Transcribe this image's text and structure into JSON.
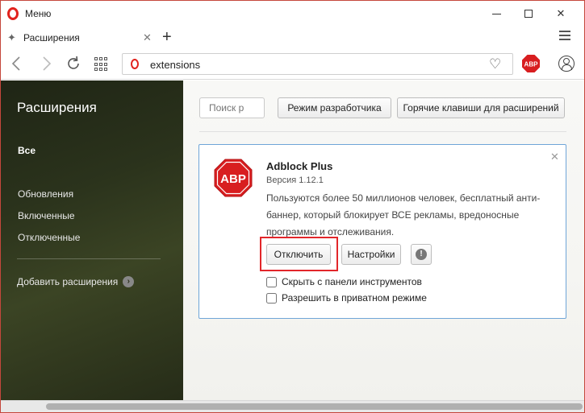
{
  "window": {
    "title": "Меню"
  },
  "tab": {
    "title": "Расширения",
    "close": "✕",
    "new_tab": "+"
  },
  "toolbar": {
    "url": "extensions"
  },
  "sidebar": {
    "title": "Расширения",
    "items": [
      {
        "label": "Все"
      },
      {
        "label": "Обновления"
      },
      {
        "label": "Включенные"
      },
      {
        "label": "Отключенные"
      }
    ],
    "add_label": "Добавить расширения"
  },
  "main": {
    "search_placeholder": "Поиск р",
    "dev_mode_label": "Режим разработчика",
    "hotkeys_label": "Горячие клавиши для расширений"
  },
  "extension": {
    "name": "Adblock Plus",
    "version": "Версия 1.12.1",
    "description": "Пользуются более 50 миллионов человек, бесплатный анти-баннер, который блокирует ВСЕ рекламы, вредоносные программы и отслеживания.",
    "logo_text": "ABP",
    "disable_label": "Отключить",
    "settings_label": "Настройки",
    "info_label": "!",
    "hide_toolbar_label": "Скрыть с панели инструментов",
    "private_mode_label": "Разрешить в приватном режиме",
    "hide_toolbar_checked": false,
    "private_mode_checked": false
  },
  "colors": {
    "brand_red": "#e1221d",
    "abp_red": "#d81e20",
    "card_border": "#6fa5d8",
    "highlight": "#e2262a"
  }
}
